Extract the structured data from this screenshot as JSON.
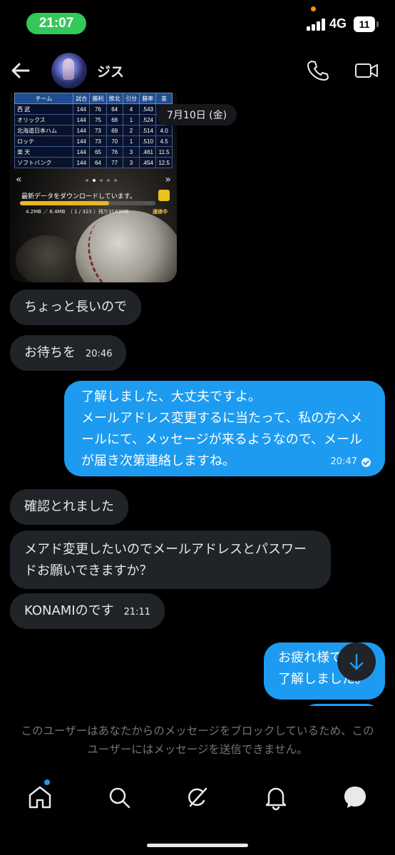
{
  "status_bar": {
    "time": "21:07",
    "network": "4G",
    "battery": "11"
  },
  "header": {
    "contact_name": "ジス"
  },
  "image_message": {
    "standings_headers": [
      "チーム",
      "試合",
      "勝利",
      "敗北",
      "引分",
      "勝率",
      "差"
    ],
    "standings_rows": [
      [
        "西 武",
        "144",
        "76",
        "64",
        "4",
        ".543",
        ""
      ],
      [
        "オリックス",
        "144",
        "75",
        "68",
        "1",
        ".524",
        ""
      ],
      [
        "北海道日本ハム",
        "144",
        "73",
        "69",
        "2",
        ".514",
        "4.0"
      ],
      [
        "ロッテ",
        "144",
        "73",
        "70",
        "1",
        ".510",
        "4.5"
      ],
      [
        "楽 天",
        "144",
        "65",
        "76",
        "3",
        ".461",
        "11.5"
      ],
      [
        "ソフトバンク",
        "144",
        "64",
        "77",
        "3",
        ".454",
        "12.5"
      ]
    ],
    "arrow_left": "«",
    "arrow_right": "»",
    "download_text": "最新データをダウンロードしています。",
    "download_progress": 0.66,
    "download_stats": "4.2MB ／ 6.4MB　（ 1 / 323 ）残り3183MB",
    "download_status": "通信中"
  },
  "date_label": "7月10日 (金)",
  "messages": [
    {
      "id": "m1",
      "direction": "in",
      "text": "ちょっと長いので",
      "time": ""
    },
    {
      "id": "m2",
      "direction": "in",
      "text": "お待ちを",
      "time": "20:46"
    },
    {
      "id": "m3",
      "direction": "out",
      "lines": [
        "了解しました、大丈夫ですよ。",
        "メールアドレス変更するに当たって、私の方へメ",
        "ールにて、メッセージが来るようなので、メール",
        "が届き次第連絡しますね。"
      ],
      "time": "20:47"
    },
    {
      "id": "m4",
      "direction": "in",
      "text": "確認とれました",
      "time": ""
    },
    {
      "id": "m5",
      "direction": "in",
      "lines": [
        "メアド変更したいのでメールアドレスとパスワー",
        "ドお願いできますか？"
      ],
      "time": ""
    },
    {
      "id": "m6",
      "direction": "in",
      "text": "KONAMIのです",
      "time": "21:11"
    },
    {
      "id": "m7",
      "direction": "out",
      "lines": [
        "お疲れ様で",
        "了解しました。"
      ],
      "time": ""
    }
  ],
  "blocked_notice": "このユーザーはあなたからのメッセージをブロックしているため、このユーザーにはメッセージを送信できません。",
  "nav": {
    "items": [
      "home-icon",
      "search-icon",
      "grok-icon",
      "notifications-icon",
      "messages-icon"
    ],
    "accent": "#1d9bf0"
  }
}
